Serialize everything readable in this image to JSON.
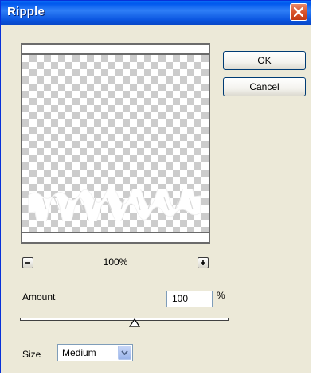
{
  "window": {
    "title": "Ripple"
  },
  "buttons": {
    "ok_label": "OK",
    "cancel_label": "Cancel"
  },
  "preview": {
    "zoom_level": "100%",
    "zoom_out_icon": "minus-icon",
    "zoom_in_icon": "plus-icon",
    "background": "transparency-checkerboard"
  },
  "amount": {
    "label": "Amount",
    "value": "100",
    "unit": "%",
    "slider_position": 0.55
  },
  "size": {
    "label": "Size",
    "selected": "Medium"
  },
  "colors": {
    "titlebar": "#0058ee",
    "dialog_bg": "#ece9d8",
    "close_button": "#d9542d"
  }
}
